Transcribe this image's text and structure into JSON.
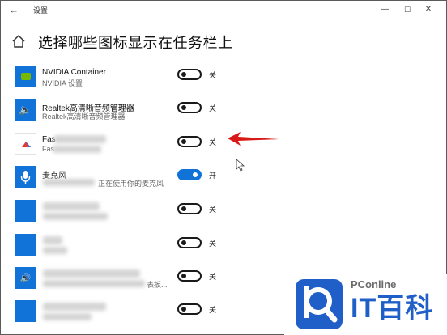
{
  "window": {
    "title": "设置",
    "back_glyph": "←",
    "min_glyph": "—",
    "max_glyph": "☐",
    "close_glyph": "✕"
  },
  "page": {
    "title": "选择哪些图标显示在任务栏上"
  },
  "toggle_states": {
    "off": "关",
    "on": "开"
  },
  "rows": [
    {
      "name": "NVIDIA Container",
      "sub": "NVIDIA 设置",
      "state": "关"
    },
    {
      "name": "Realtek高清晰音频管理器",
      "sub": "Realtek高清晰音频管理器",
      "state": "关"
    },
    {
      "name": "Fas",
      "sub": "Fas",
      "state": "关"
    },
    {
      "name": "麦克风",
      "sub": "正在使用你的麦克风",
      "state": "开"
    },
    {
      "name": "",
      "sub": "",
      "state": "关"
    },
    {
      "name": "",
      "sub": "",
      "state": "关"
    },
    {
      "name": "",
      "sub": "表扳...",
      "state": "关"
    },
    {
      "name": "",
      "sub": "",
      "state": "关"
    }
  ],
  "watermark": {
    "brand": "PConline",
    "cn": "IT百科"
  },
  "colors": {
    "accent": "#1173d8",
    "arrow": "#d91818",
    "watermark_blue": "#1f5fc7"
  }
}
